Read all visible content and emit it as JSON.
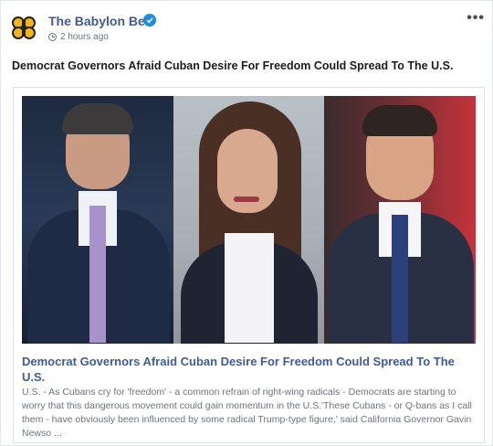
{
  "page": {
    "name": "The Babylon Bee",
    "timestamp": "2 hours ago",
    "more_label": "•••",
    "icons": {
      "avatar": "babylon-bee-logo",
      "verified": "verified-badge-icon",
      "clock": "clock-icon",
      "more": "more-options-icon"
    },
    "colors": {
      "name": "#3f5b97",
      "verified": "#1c8ce0",
      "logo_yellow": "#f2b51d"
    }
  },
  "post": {
    "text": "Democrat Governors Afraid Cuban Desire For Freedom Could Spread To The U.S."
  },
  "link": {
    "title": "Democrat Governors Afraid Cuban Desire For Freedom Could Spread To The U.S.",
    "description": "U.S. - As Cubans cry for 'freedom' - a common refrain of right-wing radicals - Democrats are starting to worry that this dangerous movement could gain momentum in the U.S.'These Cubans - or Q-bans as I call them - have obviously been influenced by some radical Trump-type figure,' said California Governor Gavin Newso ..."
  }
}
